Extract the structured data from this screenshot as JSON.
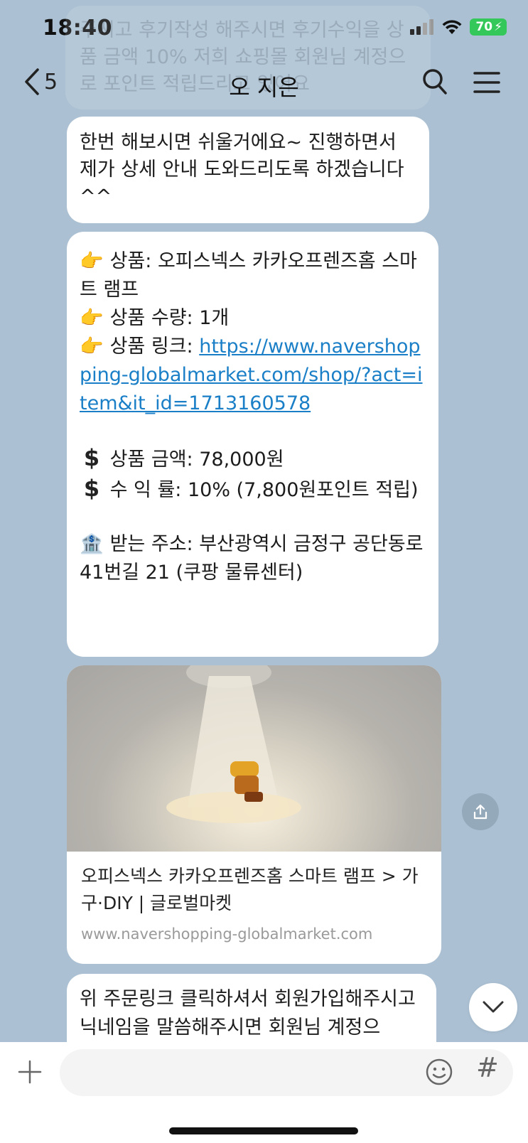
{
  "status_bar": {
    "time": "18:40",
    "battery": "70"
  },
  "faded_message": "주시고 후기작성 해주시면 후기수익을 상품 금액 10% 저희 쇼핑몰 회원님 계정으로 포인트 적립드리고 있어요",
  "header": {
    "back_count": "5",
    "title": "오 지은"
  },
  "messages": {
    "m1": "한번 해보시면 쉬울거에요~ 진행하면서 제가 상세 안내 도와드리도록 하겠습니다 ^^",
    "m2": {
      "product_label": "상품: 오피스넥스 카카오프렌즈홈 스마트 램프",
      "quantity_label": "상품 수량: 1개",
      "link_label": "상품 링크: ",
      "link_url": "https://www.navershopping-globalmarket.com/shop/?act=item&it_id=1713160578",
      "price_label": "상품 금액:  78,000원",
      "profit_label": "수 익 률: 10% (7,800원포인트 적립)",
      "address_label": "받는 주소: 부산광역시 금정구 공단동로41번길 21 (쿠팡 물류센터)"
    },
    "card": {
      "title": "오피스넥스  카카오프렌즈홈 스마트 램프 > 가구·DIY | 글로벌마켓",
      "url": "www.navershopping-globalmarket.com"
    },
    "m3": "위 주문링크 클릭하셔서 회원가입해주시고 닉네임을 말씀해주시면 회원님 계정으"
  },
  "input": {
    "placeholder": ""
  },
  "colors": {
    "background": "#abc1d3",
    "bubble": "#ffffff",
    "link": "#1a7fc7",
    "battery": "#34c759"
  }
}
